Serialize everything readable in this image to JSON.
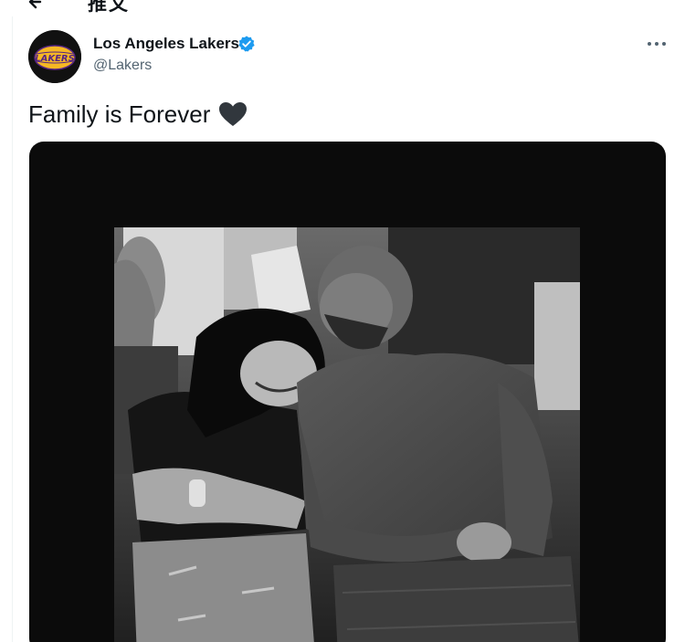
{
  "header": {
    "title": "推文"
  },
  "tweet": {
    "author_name": "Los Angeles Lakers",
    "author_handle": "@Lakers",
    "avatar_text": "LAKERS",
    "text": "Family is Forever",
    "emoji_icon": "black-heart-icon"
  },
  "colors": {
    "verified": "#1d9bf0",
    "name_text": "#0f1419",
    "handle_text": "#536471",
    "lakers_gold": "#f6b824",
    "media_background": "#0b0b0b"
  }
}
